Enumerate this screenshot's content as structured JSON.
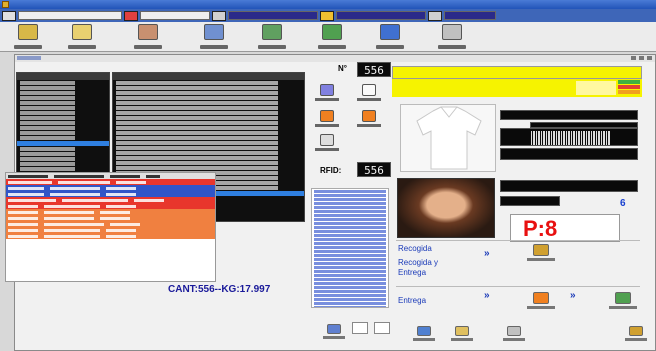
{
  "main": {
    "n_label": "N°",
    "n_value": "556",
    "rfid_label": "RFID:",
    "rfid_value": "556",
    "p_value": "P:8",
    "six": "6",
    "cant": "CANT:556--KG:17.997"
  },
  "actions": {
    "recogida": "Recogida",
    "recogida_entrega": "Recogida y Entrega",
    "entrega": "Entrega"
  },
  "colors": {
    "title_bar": "#2254b8",
    "yellow": "#f6f300",
    "red_row": "#e8362c",
    "blue_row": "#3055c8",
    "orange_row": "#f08040",
    "accent_red": "#e81010"
  }
}
